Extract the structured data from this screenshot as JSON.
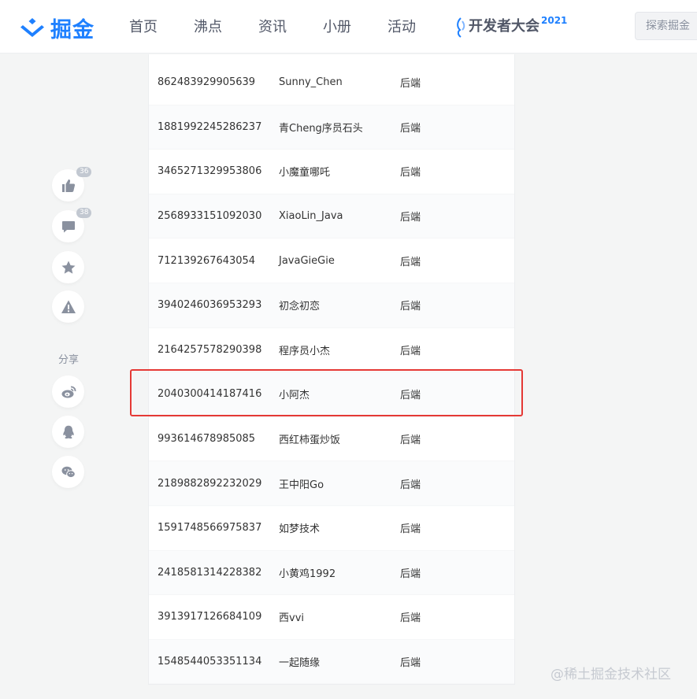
{
  "header": {
    "brand": "掘金",
    "nav": [
      "首页",
      "沸点",
      "资讯",
      "小册",
      "活动"
    ],
    "conference": {
      "label": "开发者大会",
      "year": "2021"
    },
    "search_placeholder": "探索掘金",
    "brand_color": "#1e80ff"
  },
  "sidebar": {
    "like_count": "36",
    "comment_count": "38",
    "share_label": "分享",
    "icons": [
      "thumb-up-icon",
      "comment-icon",
      "star-icon",
      "warning-icon",
      "weibo-icon",
      "qq-icon",
      "wechat-icon"
    ]
  },
  "table": {
    "rows": [
      {
        "id": "862483929905639",
        "name": "Sunny_Chen",
        "tag": "后端"
      },
      {
        "id": "1881992245286237",
        "name": "青Cheng序员石头",
        "tag": "后端"
      },
      {
        "id": "3465271329953806",
        "name": "小魔童哪吒",
        "tag": "后端"
      },
      {
        "id": "2568933151092030",
        "name": "XiaoLin_Java",
        "tag": "后端"
      },
      {
        "id": "712139267643054",
        "name": "JavaGieGie",
        "tag": "后端"
      },
      {
        "id": "3940246036953293",
        "name": "初念初恋",
        "tag": "后端"
      },
      {
        "id": "2164257578290398",
        "name": "程序员小杰",
        "tag": "后端"
      },
      {
        "id": "2040300414187416",
        "name": "小阿杰",
        "tag": "后端"
      },
      {
        "id": "993614678985085",
        "name": "西红柿蛋炒饭",
        "tag": "后端"
      },
      {
        "id": "2189882892232029",
        "name": "王中阳Go",
        "tag": "后端"
      },
      {
        "id": "1591748566975837",
        "name": "如梦技术",
        "tag": "后端"
      },
      {
        "id": "2418581314228382",
        "name": "小黄鸡1992",
        "tag": "后端"
      },
      {
        "id": "3913917126684109",
        "name": "西vvi",
        "tag": "后端"
      },
      {
        "id": "1548544053351134",
        "name": "一起随缘",
        "tag": "后端"
      }
    ],
    "highlight_color": "#e53935"
  },
  "watermark": "@稀土掘金技术社区"
}
